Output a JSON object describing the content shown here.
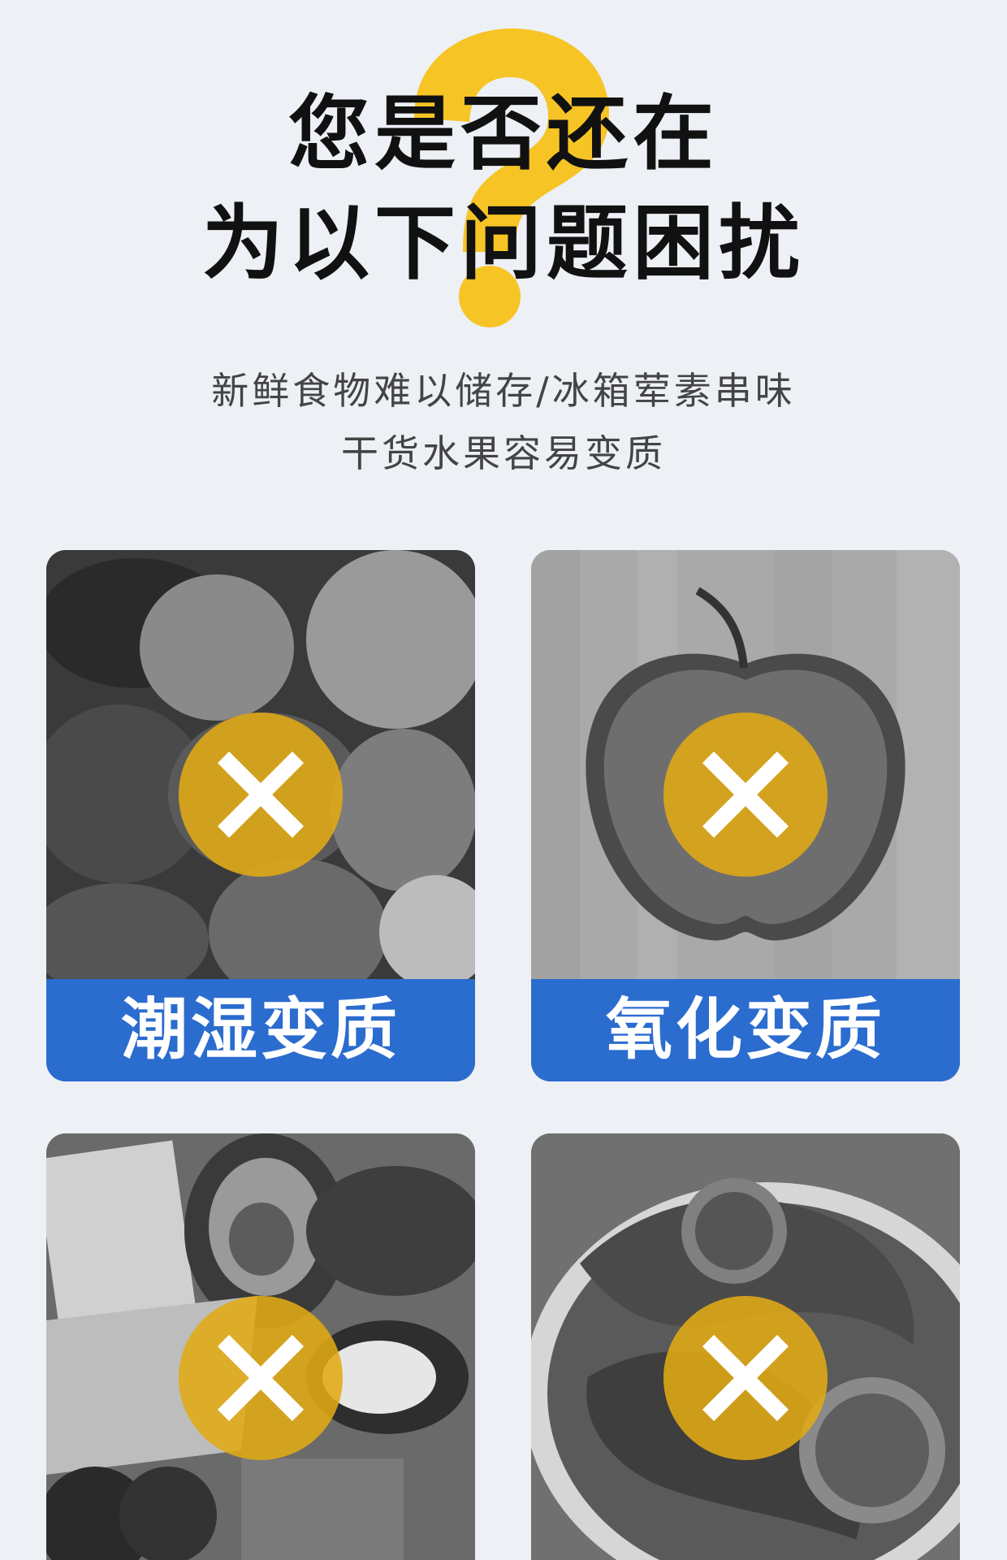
{
  "header": {
    "title_line1": "您是否还在",
    "title_line2": "为以下问题困扰",
    "subtitle_line1": "新鲜食物难以储存/冰箱荤素串味",
    "subtitle_line2": "干货水果容易变质"
  },
  "colors": {
    "background": "#edf0f5",
    "question_mark": "#f6c425",
    "label_bar": "#2b6ccf",
    "x_badge": "#e1aa14"
  },
  "icons": {
    "decor": "question-mark-icon",
    "badge": "x-mark-icon"
  },
  "problems": [
    {
      "label": "潮湿变质",
      "image": "moldy-strawberries-photo"
    },
    {
      "label": "氧化变质",
      "image": "oxidized-apple-photo"
    },
    {
      "label": "",
      "image": "mixed-food-photo"
    },
    {
      "label": "",
      "image": "dried-food-plate-photo"
    }
  ]
}
